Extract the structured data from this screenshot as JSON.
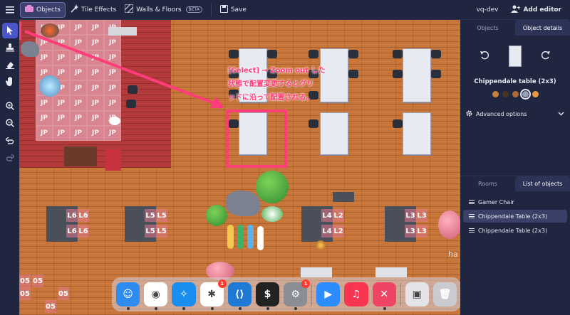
{
  "topbar": {
    "objects_label": "Objects",
    "tile_effects_label": "Tile Effects",
    "walls_floors_label": "Walls & Floors",
    "beta_label": "BETA",
    "save_label": "Save",
    "user_label": "vq-dev",
    "add_editor_label": "Add editor"
  },
  "canvas": {
    "annotation_lines": [
      "[Select] → Zoom out した",
      "状態で配置変更するとグリ",
      "ッドに沿って配置される。"
    ],
    "floor_tiles": [
      "JP",
      "JP",
      "JP",
      "JP",
      "JP",
      "JP",
      "JP",
      "JP",
      "JP",
      "JP",
      "JP",
      "JP",
      "JP",
      "JP",
      "JP",
      "JP",
      "JP",
      "JP",
      "JP",
      "JP",
      "JP",
      "JP",
      "JP",
      "JP",
      "JP",
      "JP",
      "JP",
      "JP",
      "JP",
      "JP",
      "JP",
      "JP",
      "JP",
      "JP",
      "JP",
      "JP",
      "JP",
      "JP",
      "JP",
      "JP"
    ],
    "seat_labels": [
      "L6",
      "L6",
      "L6",
      "L6",
      "L5",
      "L5",
      "L5",
      "L5",
      "L4",
      "L2",
      "L4",
      "L2",
      "L3",
      "L3",
      "L3",
      "L3"
    ],
    "bottom_labels": [
      "05",
      "05",
      "05",
      "05",
      "05"
    ],
    "partial_text": "ha"
  },
  "dock": {
    "apps": [
      {
        "name": "finder-icon",
        "glyph": "☺",
        "color": "#2e8cf0"
      },
      {
        "name": "chrome-icon",
        "glyph": "◉",
        "color": "#ffffff"
      },
      {
        "name": "safari-icon",
        "glyph": "✧",
        "color": "#1a8ef0"
      },
      {
        "name": "slack-icon",
        "glyph": "✱",
        "color": "#ffffff",
        "badge": "1"
      },
      {
        "name": "vscode-icon",
        "glyph": "⟨⟩",
        "color": "#1f7ad4"
      },
      {
        "name": "terminal-icon",
        "glyph": "$",
        "color": "#222222"
      },
      {
        "name": "system-settings-icon",
        "glyph": "⚙",
        "color": "#8a8d94",
        "badge": "1"
      },
      {
        "name": "zoom-icon",
        "glyph": "▶",
        "color": "#2d8cff"
      },
      {
        "name": "music-icon",
        "glyph": "♫",
        "color": "#fa3552"
      },
      {
        "name": "cursor-app-icon",
        "glyph": "✕",
        "color": "#ee4466"
      },
      {
        "name": "screenshot-icon",
        "glyph": "▣",
        "color": "#e4e4e8"
      },
      {
        "name": "trash-icon",
        "glyph": "🗑",
        "color": "#c9cbd0"
      }
    ]
  },
  "panel": {
    "tab_objects": "Objects",
    "tab_object_details": "Object details",
    "object_name": "Chippendale table (2x3)",
    "swatches": [
      "#c8803a",
      "#4a3426",
      "#b06a32",
      "#9aa0b8",
      "#e89a3c"
    ],
    "advanced_label": "Advanced options",
    "tab_rooms": "Rooms",
    "tab_list_objects": "List of objects",
    "list_items": [
      "Gamer Chair",
      "Chippendale Table (2x3)",
      "Chippendale Table (2x3)"
    ]
  }
}
